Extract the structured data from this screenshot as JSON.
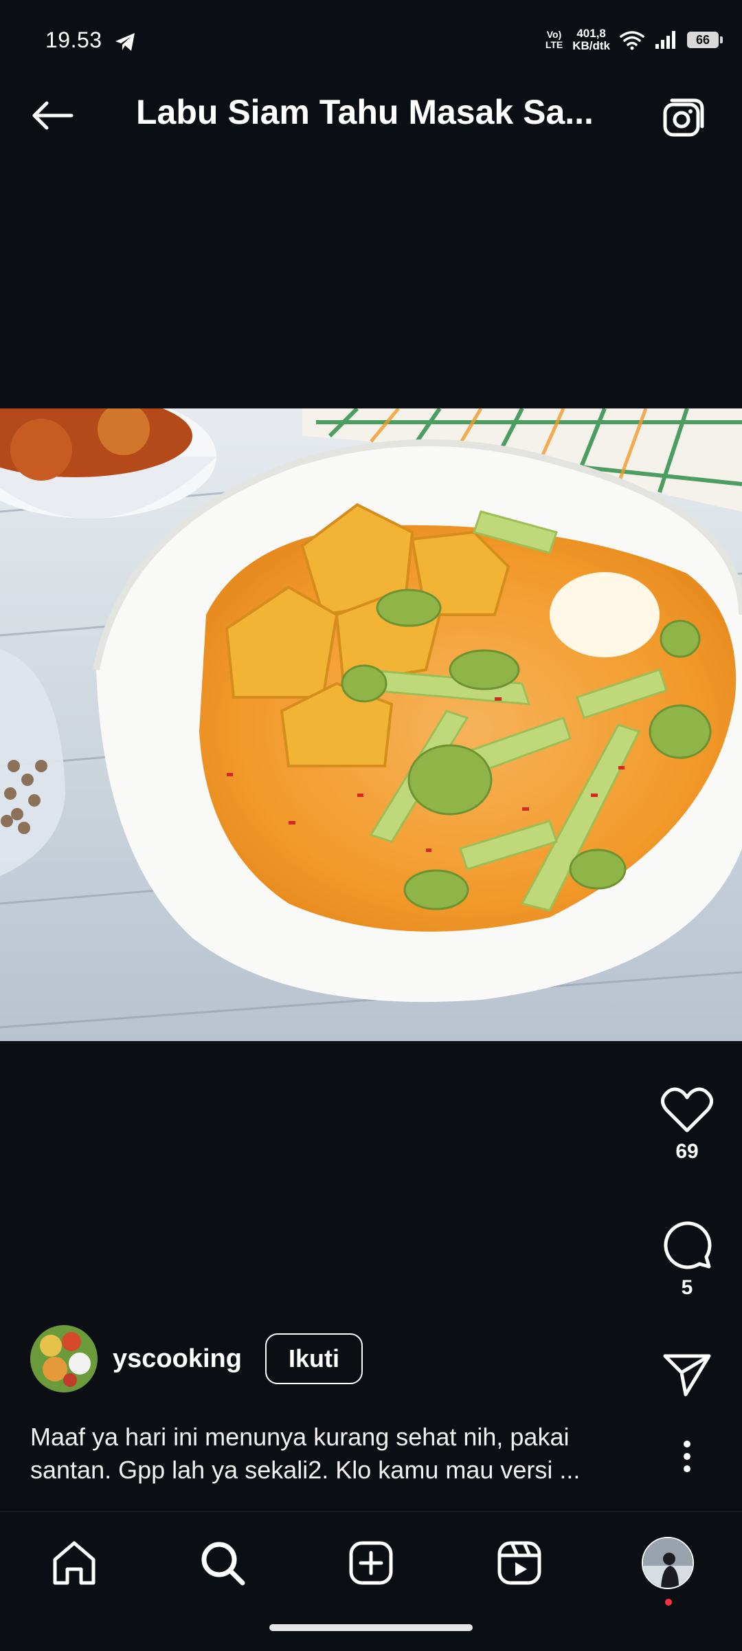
{
  "status_bar": {
    "time": "19.53",
    "volte_line1": "Vo)",
    "volte_line2": "LTE",
    "speed_value": "401,8",
    "speed_unit": "KB/dtk",
    "battery": "66"
  },
  "header": {
    "title": "Labu Siam Tahu Masak Sa..."
  },
  "post": {
    "likes": "69",
    "comments": "5",
    "author": "yscooking",
    "follow_label": "Ikuti",
    "caption_line1": "Maaf ya hari ini menunya kurang sehat nih, pakai",
    "caption_line2": "santan. Gpp lah ya sekali2. Klo kamu mau versi ..."
  },
  "icons": {
    "back": "arrow-left-icon",
    "camera": "camera-icon",
    "like": "heart-icon",
    "comment": "comment-icon",
    "share": "send-icon",
    "more": "more-vertical-icon",
    "home": "home-icon",
    "search": "search-icon",
    "create": "plus-square-icon",
    "reels": "reels-icon",
    "telegram": "telegram-icon"
  },
  "colors": {
    "background": "#0b0e13",
    "text": "#ffffff",
    "notification_dot": "#ff3040"
  }
}
